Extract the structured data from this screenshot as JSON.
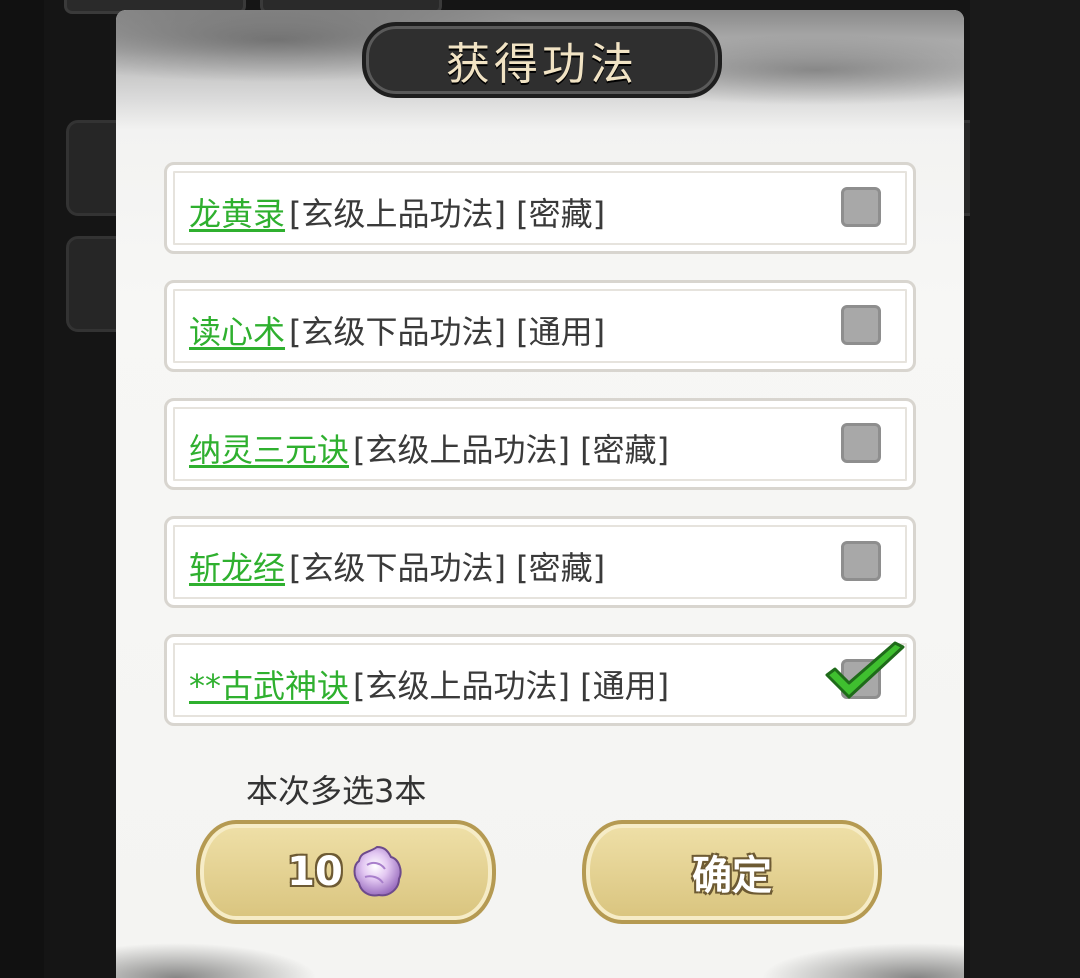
{
  "dialog": {
    "title": "获得功法",
    "hint": "本次多选3本",
    "cost_value": "10",
    "cost_icon": "spirit-stone-icon",
    "confirm_label": "确定"
  },
  "items": [
    {
      "name": "龙黄录",
      "tags": "[玄级上品功法] [密藏]",
      "checked": false
    },
    {
      "name": "读心术",
      "tags": "[玄级下品功法] [通用]",
      "checked": false
    },
    {
      "name": "纳灵三元诀",
      "tags": "[玄级上品功法] [密藏]",
      "checked": false
    },
    {
      "name": "斩龙经",
      "tags": "[玄级下品功法] [密藏]",
      "checked": false
    },
    {
      "name": "**古武神诀",
      "tags": "[玄级上品功法] [通用]",
      "checked": true
    }
  ],
  "colors": {
    "name_green": "#2fb02f",
    "check_green": "#3fbf2f",
    "button_gold": "#d9c47e"
  }
}
